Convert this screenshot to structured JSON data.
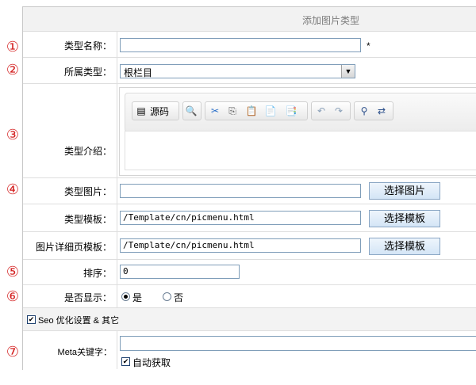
{
  "header": {
    "title": "添加图片类型"
  },
  "markers": [
    "①",
    "②",
    "③",
    "④",
    "⑤",
    "⑥",
    "⑦"
  ],
  "form": {
    "type_name": {
      "label": "类型名称：",
      "value": "",
      "required": "*"
    },
    "parent_type": {
      "label": "所属类型：",
      "selected": "根栏目"
    },
    "intro": {
      "label": "类型介绍：",
      "toolbar": {
        "source_label": "源码"
      }
    },
    "image": {
      "label": "类型图片：",
      "value": "",
      "button": "选择图片"
    },
    "template": {
      "label": "类型模板：",
      "value": "/Template/cn/picmenu.html",
      "button": "选择模板"
    },
    "detail_template": {
      "label": "图片详细页模板：",
      "value": "/Template/cn/picmenu.html",
      "button": "选择模板"
    },
    "sort": {
      "label": "排序：",
      "value": "0"
    },
    "display": {
      "label": "是否显示：",
      "yes": "是",
      "no": "否",
      "selected": "yes"
    },
    "seo": {
      "label": "Seo 优化设置 & 其它",
      "checked": true
    },
    "meta_keywords": {
      "label": "Meta关键字：",
      "value": "",
      "auto_label": "自动获取",
      "auto_checked": true
    }
  },
  "colors": {
    "marker": "#d42020",
    "button_border": "#8aa6c4",
    "input_border": "#7f9db9"
  }
}
